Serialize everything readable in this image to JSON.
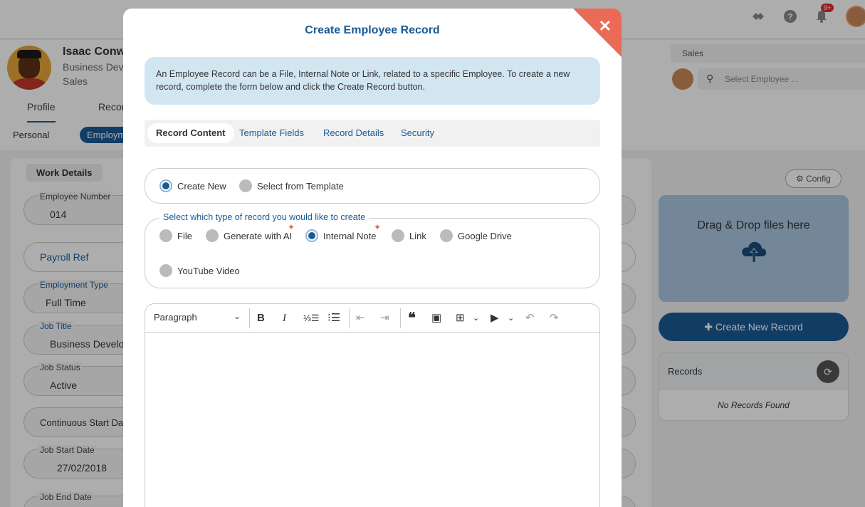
{
  "background": {
    "topbar": {
      "notification_badge": "9+"
    },
    "profile": {
      "name": "Isaac Conwa",
      "role": "Business Deve",
      "department": "Sales",
      "tabs": [
        "Profile",
        "Recor"
      ],
      "subtabs": [
        "Personal",
        "Employme"
      ]
    },
    "selector": {
      "department": "Sales",
      "employee_placeholder": "Select Employee ..."
    },
    "work_details": {
      "title": "Work Details",
      "fields": [
        {
          "label": "Employee Number",
          "value": "014"
        },
        {
          "label": "Payroll Ref",
          "value": ""
        },
        {
          "label": "Employment Type",
          "value": "Full Time"
        },
        {
          "label": "Job Title",
          "value": "Business Develo"
        },
        {
          "label": "Job Status",
          "value": "Active"
        },
        {
          "label": "Continuous Start Dat",
          "value": ""
        },
        {
          "label": "Job Start Date",
          "value": "27/02/2018"
        },
        {
          "label": "Job End Date",
          "value": ""
        }
      ]
    },
    "right_panel": {
      "config_label": "Config",
      "dropzone_text": "Drag & Drop files here",
      "create_button": "Create New Record",
      "records_title": "Records",
      "records_empty": "No Records Found"
    }
  },
  "modal": {
    "title": "Create Employee Record",
    "info": "An Employee Record can be a File, Internal Note or Link, related to a specific Employee. To create a new record, complete the form below and click the Create Record button.",
    "tabs": [
      "Record Content",
      "Template Fields",
      "Record Details",
      "Security"
    ],
    "active_tab": "Record Content",
    "source_options": [
      {
        "label": "Create New",
        "selected": true
      },
      {
        "label": "Select from Template",
        "selected": false
      }
    ],
    "type_legend": "Select which type of record you would like to create",
    "type_options": [
      {
        "label": "File",
        "selected": false
      },
      {
        "label": "Generate with AI",
        "selected": false
      },
      {
        "label": "Internal Note",
        "selected": true
      },
      {
        "label": "Link",
        "selected": false
      },
      {
        "label": "Google Drive",
        "selected": false
      },
      {
        "label": "YouTube Video",
        "selected": false
      }
    ],
    "editor": {
      "block_format": "Paragraph",
      "tools": [
        "bold-icon",
        "italic-icon",
        "numbered-list-icon",
        "bullet-list-icon",
        "outdent-icon",
        "indent-icon",
        "blockquote-icon",
        "image-icon",
        "table-icon",
        "media-icon",
        "undo-icon",
        "redo-icon"
      ]
    },
    "colors": {
      "accent": "#1a5a96",
      "close": "#ea6a57",
      "info_bg": "#d2e6f2"
    }
  }
}
